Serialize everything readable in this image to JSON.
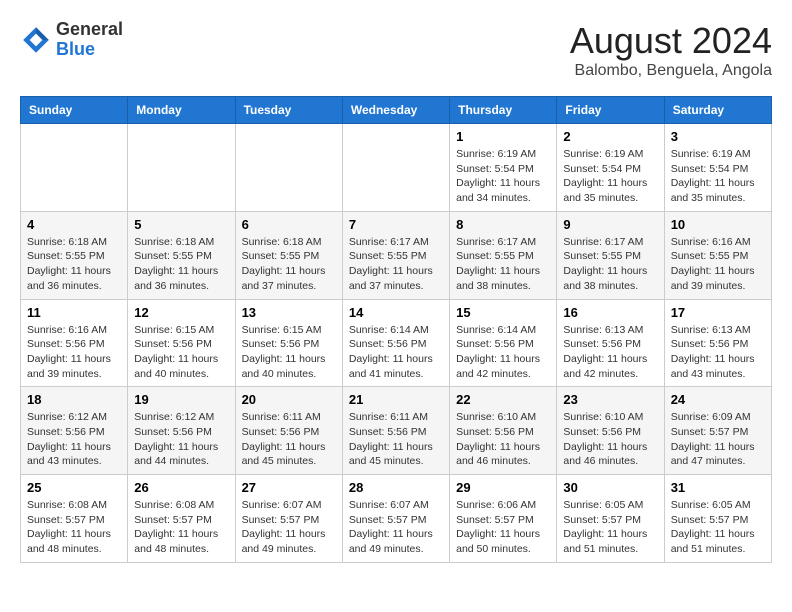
{
  "header": {
    "logo_general": "General",
    "logo_blue": "Blue",
    "month_year": "August 2024",
    "location": "Balombo, Benguela, Angola"
  },
  "weekdays": [
    "Sunday",
    "Monday",
    "Tuesday",
    "Wednesday",
    "Thursday",
    "Friday",
    "Saturday"
  ],
  "weeks": [
    [
      {
        "day": "",
        "info": ""
      },
      {
        "day": "",
        "info": ""
      },
      {
        "day": "",
        "info": ""
      },
      {
        "day": "",
        "info": ""
      },
      {
        "day": "1",
        "info": "Sunrise: 6:19 AM\nSunset: 5:54 PM\nDaylight: 11 hours\nand 34 minutes."
      },
      {
        "day": "2",
        "info": "Sunrise: 6:19 AM\nSunset: 5:54 PM\nDaylight: 11 hours\nand 35 minutes."
      },
      {
        "day": "3",
        "info": "Sunrise: 6:19 AM\nSunset: 5:54 PM\nDaylight: 11 hours\nand 35 minutes."
      }
    ],
    [
      {
        "day": "4",
        "info": "Sunrise: 6:18 AM\nSunset: 5:55 PM\nDaylight: 11 hours\nand 36 minutes."
      },
      {
        "day": "5",
        "info": "Sunrise: 6:18 AM\nSunset: 5:55 PM\nDaylight: 11 hours\nand 36 minutes."
      },
      {
        "day": "6",
        "info": "Sunrise: 6:18 AM\nSunset: 5:55 PM\nDaylight: 11 hours\nand 37 minutes."
      },
      {
        "day": "7",
        "info": "Sunrise: 6:17 AM\nSunset: 5:55 PM\nDaylight: 11 hours\nand 37 minutes."
      },
      {
        "day": "8",
        "info": "Sunrise: 6:17 AM\nSunset: 5:55 PM\nDaylight: 11 hours\nand 38 minutes."
      },
      {
        "day": "9",
        "info": "Sunrise: 6:17 AM\nSunset: 5:55 PM\nDaylight: 11 hours\nand 38 minutes."
      },
      {
        "day": "10",
        "info": "Sunrise: 6:16 AM\nSunset: 5:55 PM\nDaylight: 11 hours\nand 39 minutes."
      }
    ],
    [
      {
        "day": "11",
        "info": "Sunrise: 6:16 AM\nSunset: 5:56 PM\nDaylight: 11 hours\nand 39 minutes."
      },
      {
        "day": "12",
        "info": "Sunrise: 6:15 AM\nSunset: 5:56 PM\nDaylight: 11 hours\nand 40 minutes."
      },
      {
        "day": "13",
        "info": "Sunrise: 6:15 AM\nSunset: 5:56 PM\nDaylight: 11 hours\nand 40 minutes."
      },
      {
        "day": "14",
        "info": "Sunrise: 6:14 AM\nSunset: 5:56 PM\nDaylight: 11 hours\nand 41 minutes."
      },
      {
        "day": "15",
        "info": "Sunrise: 6:14 AM\nSunset: 5:56 PM\nDaylight: 11 hours\nand 42 minutes."
      },
      {
        "day": "16",
        "info": "Sunrise: 6:13 AM\nSunset: 5:56 PM\nDaylight: 11 hours\nand 42 minutes."
      },
      {
        "day": "17",
        "info": "Sunrise: 6:13 AM\nSunset: 5:56 PM\nDaylight: 11 hours\nand 43 minutes."
      }
    ],
    [
      {
        "day": "18",
        "info": "Sunrise: 6:12 AM\nSunset: 5:56 PM\nDaylight: 11 hours\nand 43 minutes."
      },
      {
        "day": "19",
        "info": "Sunrise: 6:12 AM\nSunset: 5:56 PM\nDaylight: 11 hours\nand 44 minutes."
      },
      {
        "day": "20",
        "info": "Sunrise: 6:11 AM\nSunset: 5:56 PM\nDaylight: 11 hours\nand 45 minutes."
      },
      {
        "day": "21",
        "info": "Sunrise: 6:11 AM\nSunset: 5:56 PM\nDaylight: 11 hours\nand 45 minutes."
      },
      {
        "day": "22",
        "info": "Sunrise: 6:10 AM\nSunset: 5:56 PM\nDaylight: 11 hours\nand 46 minutes."
      },
      {
        "day": "23",
        "info": "Sunrise: 6:10 AM\nSunset: 5:56 PM\nDaylight: 11 hours\nand 46 minutes."
      },
      {
        "day": "24",
        "info": "Sunrise: 6:09 AM\nSunset: 5:57 PM\nDaylight: 11 hours\nand 47 minutes."
      }
    ],
    [
      {
        "day": "25",
        "info": "Sunrise: 6:08 AM\nSunset: 5:57 PM\nDaylight: 11 hours\nand 48 minutes."
      },
      {
        "day": "26",
        "info": "Sunrise: 6:08 AM\nSunset: 5:57 PM\nDaylight: 11 hours\nand 48 minutes."
      },
      {
        "day": "27",
        "info": "Sunrise: 6:07 AM\nSunset: 5:57 PM\nDaylight: 11 hours\nand 49 minutes."
      },
      {
        "day": "28",
        "info": "Sunrise: 6:07 AM\nSunset: 5:57 PM\nDaylight: 11 hours\nand 49 minutes."
      },
      {
        "day": "29",
        "info": "Sunrise: 6:06 AM\nSunset: 5:57 PM\nDaylight: 11 hours\nand 50 minutes."
      },
      {
        "day": "30",
        "info": "Sunrise: 6:05 AM\nSunset: 5:57 PM\nDaylight: 11 hours\nand 51 minutes."
      },
      {
        "day": "31",
        "info": "Sunrise: 6:05 AM\nSunset: 5:57 PM\nDaylight: 11 hours\nand 51 minutes."
      }
    ]
  ]
}
